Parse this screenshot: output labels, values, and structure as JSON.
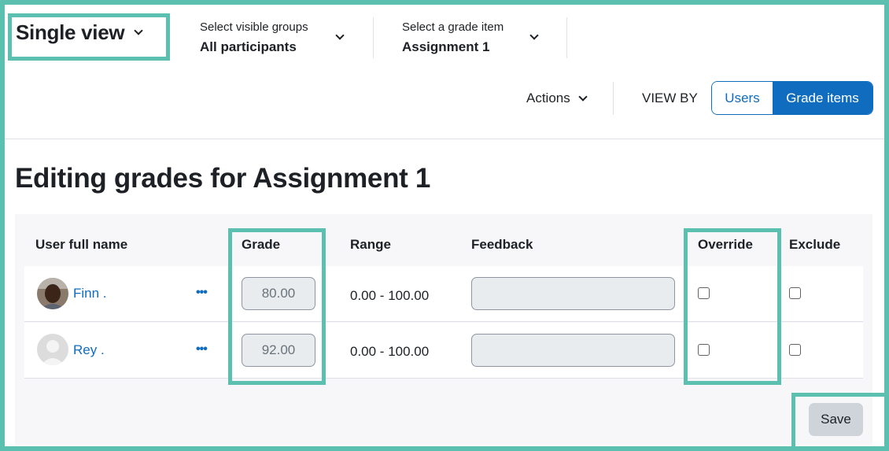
{
  "view_select": {
    "label": "Single view"
  },
  "groups_select": {
    "caption": "Select visible groups",
    "value": "All participants"
  },
  "grade_item_select": {
    "caption": "Select a grade item",
    "value": "Assignment 1"
  },
  "actions": {
    "label": "Actions"
  },
  "view_by": {
    "label": "VIEW BY",
    "options": [
      "Users",
      "Grade items"
    ],
    "selected": "Grade items"
  },
  "page_title": "Editing grades for Assignment 1",
  "table": {
    "headers": {
      "user": "User full name",
      "grade": "Grade",
      "range": "Range",
      "feedback": "Feedback",
      "override": "Override",
      "exclude": "Exclude"
    },
    "rows": [
      {
        "name": "Finn .",
        "grade": "80.00",
        "range": "0.00 - 100.00",
        "feedback": "",
        "override": false,
        "exclude": false
      },
      {
        "name": "Rey .",
        "grade": "92.00",
        "range": "0.00 - 100.00",
        "feedback": "",
        "override": false,
        "exclude": false
      }
    ]
  },
  "save_label": "Save",
  "colors": {
    "accent": "#0f6cbf",
    "highlight": "#5cc0b0"
  }
}
